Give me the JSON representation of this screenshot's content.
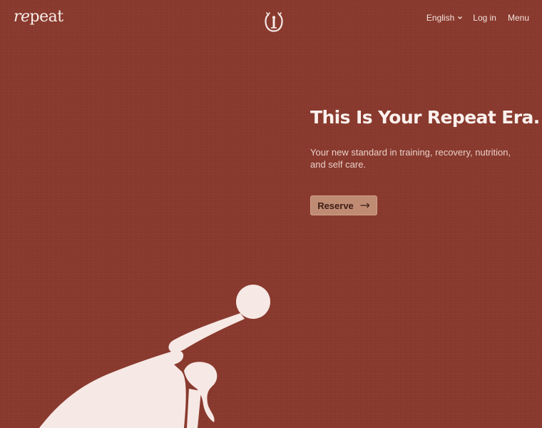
{
  "header": {
    "logo_prefix": "re",
    "logo_suffix": "peat",
    "nav": {
      "language": "English",
      "login": "Log in",
      "menu": "Menu"
    }
  },
  "hero": {
    "title": "This Is Your Repeat Era.",
    "subtitle": "Your new standard in training, recovery, nutrition, and self care.",
    "cta_label": "Reserve"
  },
  "colors": {
    "background": "#8a3a2e",
    "text": "#f5e9e6",
    "button": "#c08b73",
    "illustration": "#f6e8e5"
  },
  "icons": [
    "brand-emblem-icon",
    "chevron-down-icon",
    "arrow-right-icon",
    "kettlebell-athlete-illustration"
  ]
}
